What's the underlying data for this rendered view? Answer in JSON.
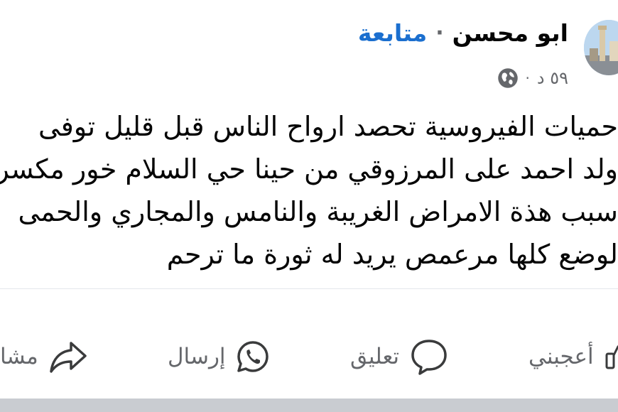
{
  "post": {
    "author": "ابو محسن",
    "separator": "·",
    "follow_label": "متابعة",
    "time": "٥٩ د",
    "time_separator": "·",
    "privacy_icon": "globe-icon",
    "text_lines": [
      "حميات الفيروسية تحصد ارواح الناس قبل قليل توفى",
      "ولد احمد على المرزوقي من حينا حي السلام خور مكسر",
      "سبب هذة الامراض الغريبة والنامس والمجاري والحمى",
      "لوضع كلها مرعمص يريد له ثورة ما ترحم"
    ]
  },
  "actions": {
    "like": {
      "label": "أعجبني",
      "icon": "like-icon"
    },
    "comment": {
      "label": "تعليق",
      "icon": "comment-icon"
    },
    "send": {
      "label": "إرسال",
      "icon": "whatsapp-icon"
    },
    "share": {
      "label": "مشا",
      "icon": "share-icon"
    }
  },
  "colors": {
    "follow": "#1b6fcf",
    "secondary_text": "#65676b",
    "divider": "#e4e6eb"
  }
}
